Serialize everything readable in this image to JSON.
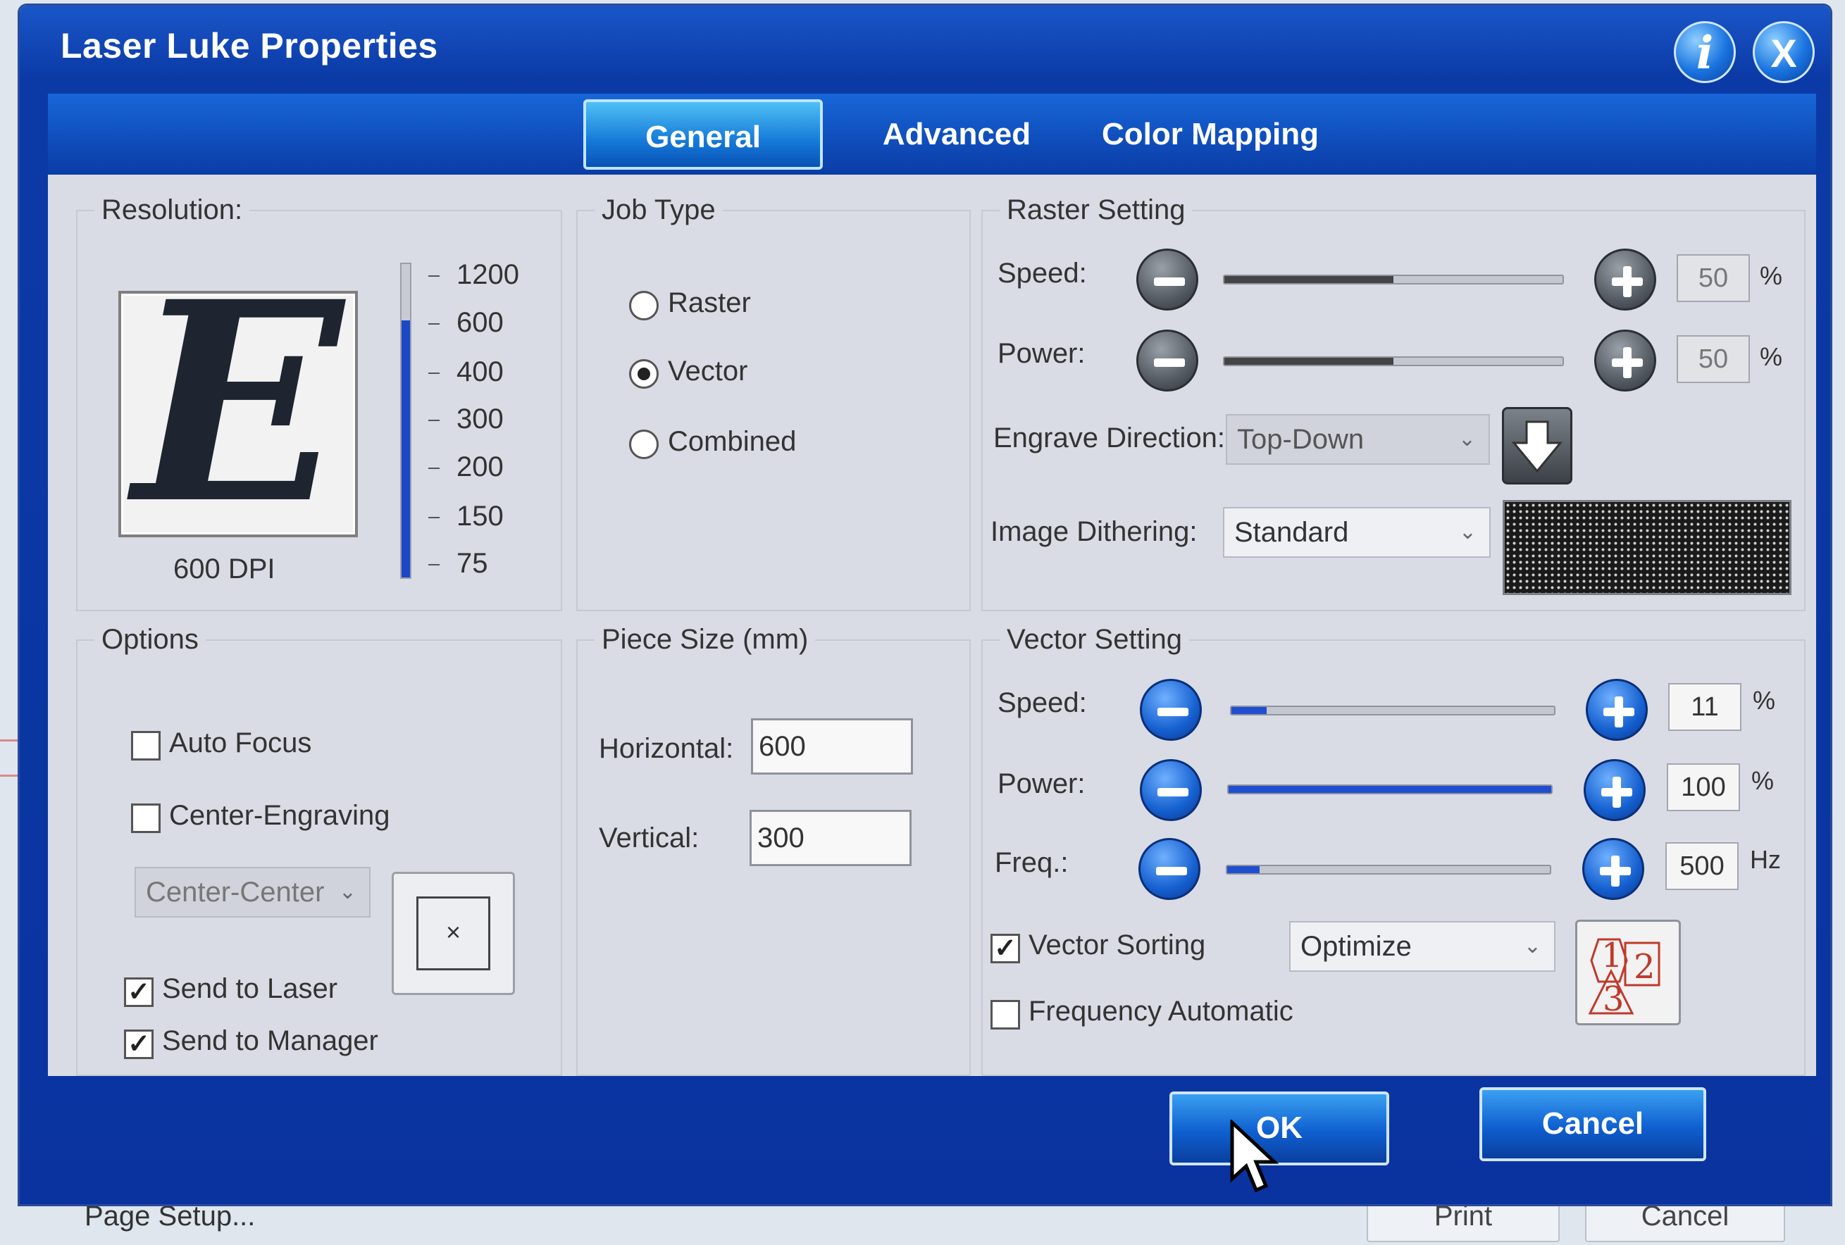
{
  "background": {
    "page_setup_label": "Page Setup...",
    "print_label": "Print",
    "cancel_label": "Cancel"
  },
  "window": {
    "title": "Laser Luke Properties",
    "info_label": "i",
    "close_label": "X"
  },
  "tabs": [
    {
      "label": "General",
      "active": true
    },
    {
      "label": "Advanced",
      "active": false
    },
    {
      "label": "Color Mapping",
      "active": false
    }
  ],
  "resolution": {
    "title": "Resolution:",
    "preview_letter": "E",
    "dpi_label": "600 DPI",
    "ticks": [
      "1200",
      "600",
      "400",
      "300",
      "200",
      "150",
      "75"
    ]
  },
  "job_type": {
    "title": "Job Type",
    "options": [
      {
        "label": "Raster",
        "selected": false
      },
      {
        "label": "Vector",
        "selected": true
      },
      {
        "label": "Combined",
        "selected": false
      }
    ]
  },
  "raster_setting": {
    "title": "Raster Setting",
    "speed": {
      "label": "Speed:",
      "value": "50",
      "unit": "%",
      "level": 0.5
    },
    "power": {
      "label": "Power:",
      "value": "50",
      "unit": "%",
      "level": 0.5
    },
    "engrave_direction": {
      "label": "Engrave Direction:",
      "value": "Top-Down"
    },
    "image_dithering": {
      "label": "Image Dithering:",
      "value": "Standard"
    }
  },
  "options": {
    "title": "Options",
    "auto_focus": {
      "label": "Auto Focus",
      "checked": false
    },
    "center_engraving": {
      "label": "Center-Engraving",
      "checked": false
    },
    "center_select": "Center-Center",
    "center_marker": "×",
    "send_to_laser": {
      "label": "Send to Laser",
      "checked": true
    },
    "send_to_manager": {
      "label": "Send to Manager",
      "checked": true
    }
  },
  "piece_size": {
    "title": "Piece Size (mm)",
    "horizontal_label": "Horizontal:",
    "horizontal_value": "600",
    "vertical_label": "Vertical:",
    "vertical_value": "300"
  },
  "vector_setting": {
    "title": "Vector Setting",
    "speed": {
      "label": "Speed:",
      "value": "11",
      "unit": "%",
      "level": 0.11
    },
    "power": {
      "label": "Power:",
      "value": "100",
      "unit": "%",
      "level": 1.0
    },
    "freq": {
      "label": "Freq.:",
      "value": "500",
      "unit": "Hz",
      "level": 0.1
    },
    "vector_sorting": {
      "label": "Vector Sorting",
      "checked": true,
      "value": "Optimize"
    },
    "frequency_automatic": {
      "label": "Frequency Automatic",
      "checked": false
    }
  },
  "sort_icon": {
    "n1": "1",
    "n2": "2",
    "n3": "3"
  },
  "buttons": {
    "ok": "OK",
    "cancel": "Cancel"
  }
}
